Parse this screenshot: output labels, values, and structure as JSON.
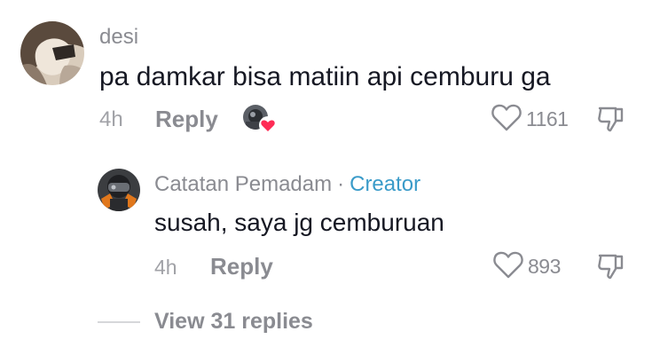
{
  "comment": {
    "username": "desi",
    "text": "pa damkar bisa matiin api cemburu ga",
    "time": "4h",
    "reply_label": "Reply",
    "like_count": "1161",
    "icons": {
      "like": "heart-outline-icon",
      "dislike": "thumbs-down-icon",
      "creator_liked": "creator-liked-heart-icon"
    }
  },
  "reply": {
    "username": "Catatan Pemadam",
    "separator": "·",
    "badge": "Creator",
    "text": "susah, saya jg cemburuan",
    "time": "4h",
    "reply_label": "Reply",
    "like_count": "893"
  },
  "view_replies_label": "View 31 replies",
  "colors": {
    "text_primary": "#161823",
    "text_secondary": "#8a8b91",
    "creator_badge": "#3a9bc9",
    "heart_badge": "#fe2c55"
  }
}
